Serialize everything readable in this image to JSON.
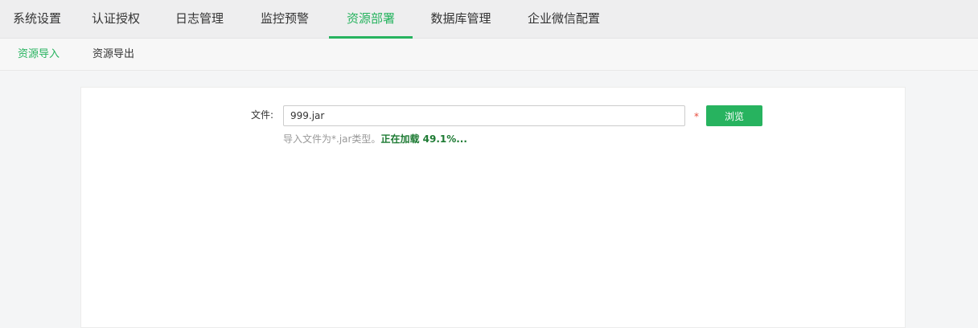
{
  "topnav": {
    "tabs": [
      {
        "label": "系统设置"
      },
      {
        "label": "认证授权"
      },
      {
        "label": "日志管理"
      },
      {
        "label": "监控预警"
      },
      {
        "label": "资源部署",
        "active": true
      },
      {
        "label": "数据库管理"
      },
      {
        "label": "企业微信配置"
      }
    ]
  },
  "subnav": {
    "tabs": [
      {
        "label": "资源导入",
        "active": true
      },
      {
        "label": "资源导出"
      }
    ]
  },
  "form": {
    "file_label": "文件:",
    "file_value": "999.jar",
    "required_mark": "*",
    "browse_label": "浏览",
    "hint_text": "导入文件为*.jar类型。",
    "loading_text": "正在加载 49.1%...",
    "loading_progress_percent": 49.1
  },
  "colors": {
    "accent": "#27b35f",
    "loading_text": "#1e7b34",
    "required": "#e74c3c"
  }
}
